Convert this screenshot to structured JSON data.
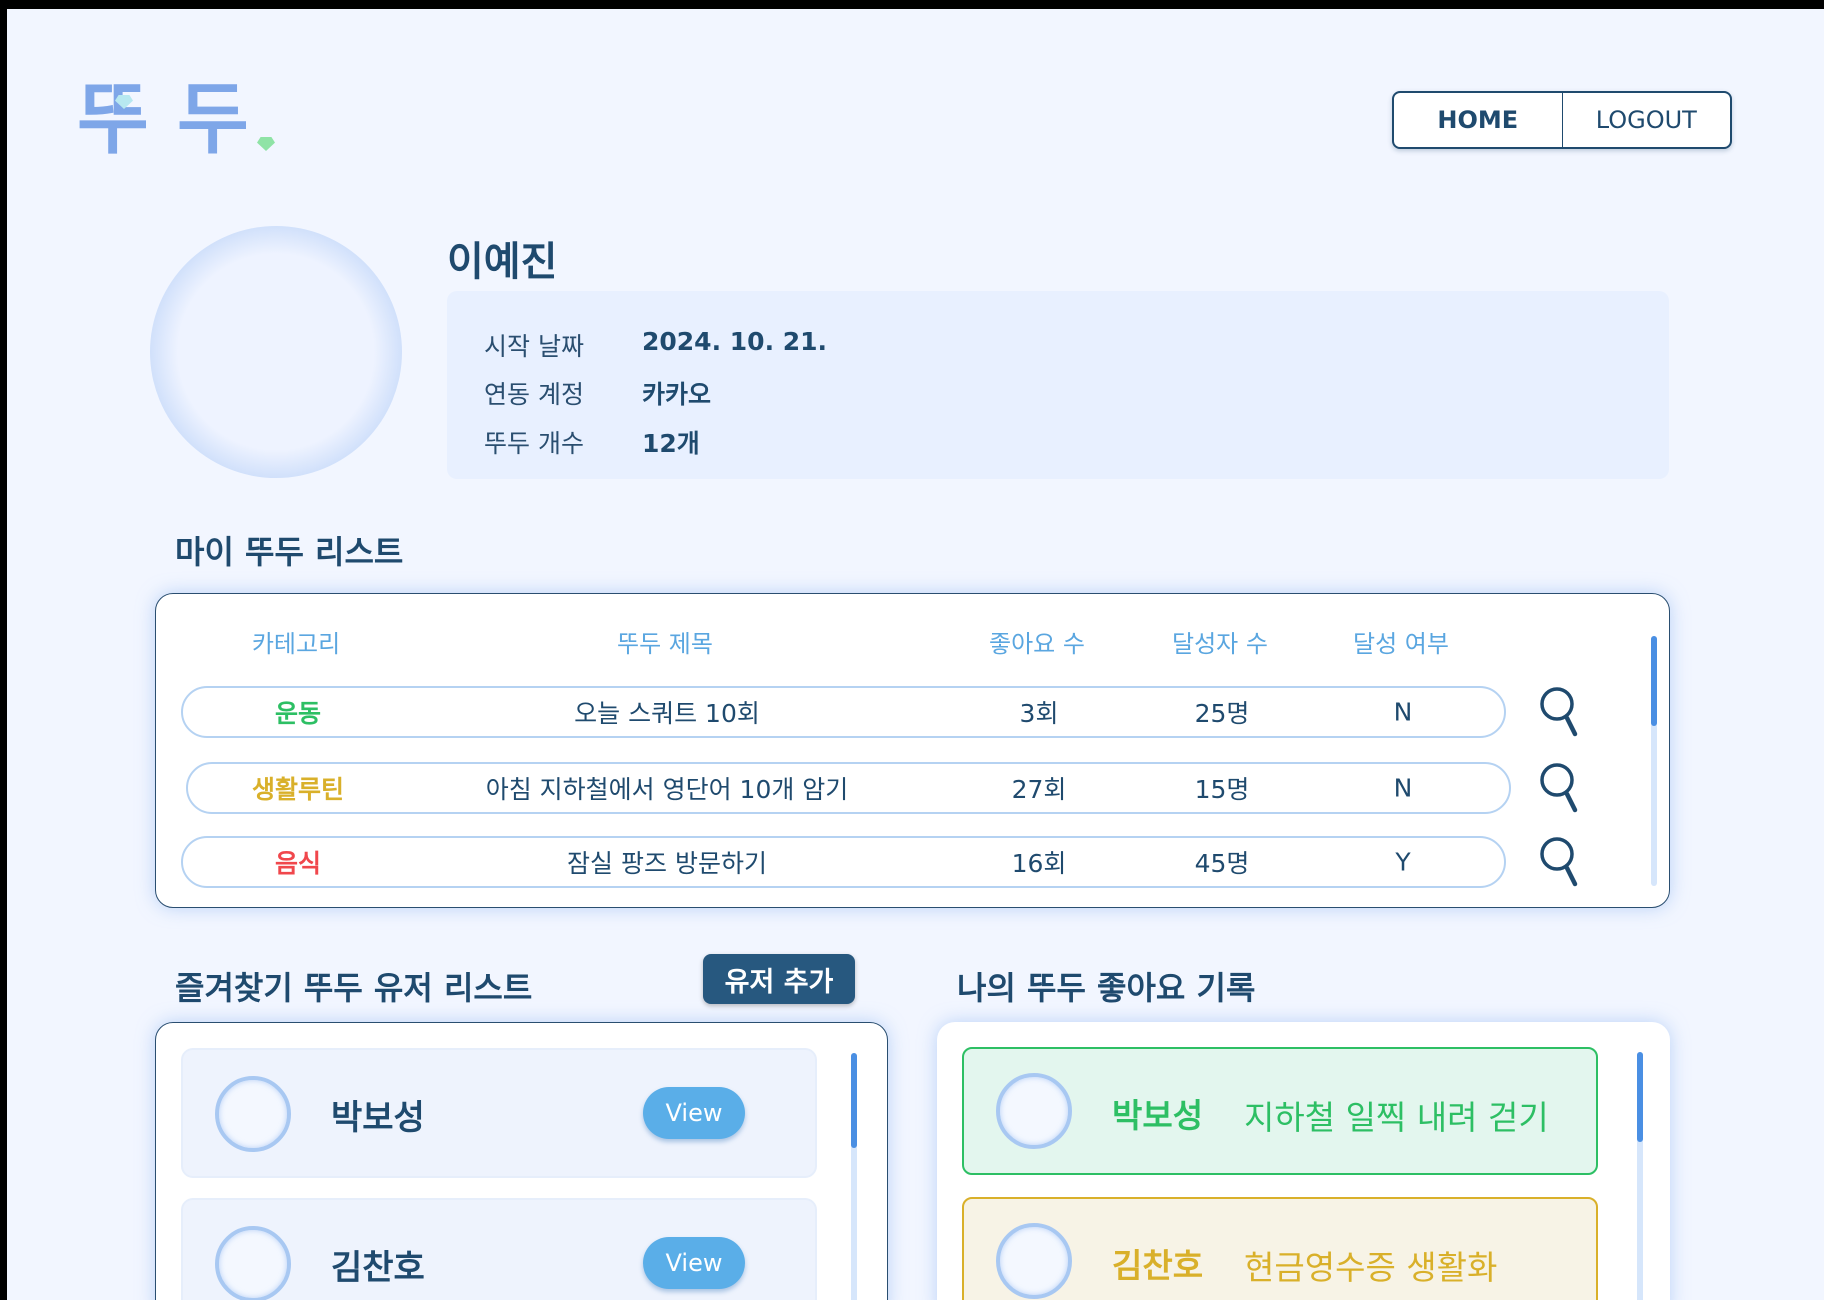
{
  "logo": {
    "part1": "뚜",
    "part2": "두"
  },
  "nav": {
    "home": "HOME",
    "logout": "LOGOUT"
  },
  "profile": {
    "name": "이예진",
    "rows": [
      {
        "label": "시작 날짜",
        "value": "2024. 10. 21."
      },
      {
        "label": "연동 계정",
        "value": "카카오"
      },
      {
        "label": "뚜두 개수",
        "value": "12개"
      }
    ]
  },
  "my_list": {
    "title": "마이 뚜두 리스트",
    "headers": [
      "카테고리",
      "뚜두 제목",
      "좋아요 수",
      "달성자 수",
      "달성 여부"
    ],
    "rows": [
      {
        "category": "운동",
        "category_color": "#2dbf64",
        "title": "오늘 스쿼트 10회",
        "likes": "3회",
        "achievers": "25명",
        "done": "N"
      },
      {
        "category": "생활루틴",
        "category_color": "#d9b02a",
        "title": "아침 지하철에서 영단어 10개 암기",
        "likes": "27회",
        "achievers": "15명",
        "done": "N"
      },
      {
        "category": "음식",
        "category_color": "#f0474c",
        "title": "잠실 팡즈 방문하기",
        "likes": "16회",
        "achievers": "45명",
        "done": "Y"
      }
    ]
  },
  "fav_users": {
    "title": "즐겨찾기 뚜두 유저 리스트",
    "add_button": "유저 추가",
    "users": [
      {
        "name": "박보성",
        "view": "View"
      },
      {
        "name": "김찬호",
        "view": "View"
      }
    ]
  },
  "likes_log": {
    "title": "나의 뚜두 좋아요 기록",
    "items": [
      {
        "name": "박보성",
        "text": "지하철 일찍 내려 걷기",
        "color": "#2dbf64",
        "bg": "#e3f6ee"
      },
      {
        "name": "김찬호",
        "text": "현금영수증 생활화",
        "color": "#d9b02a",
        "bg": "#f7f3e6"
      }
    ]
  },
  "colors": {
    "accent": "#1f4a6e",
    "link": "#5aa6e0",
    "background": "#f2f6ff"
  }
}
